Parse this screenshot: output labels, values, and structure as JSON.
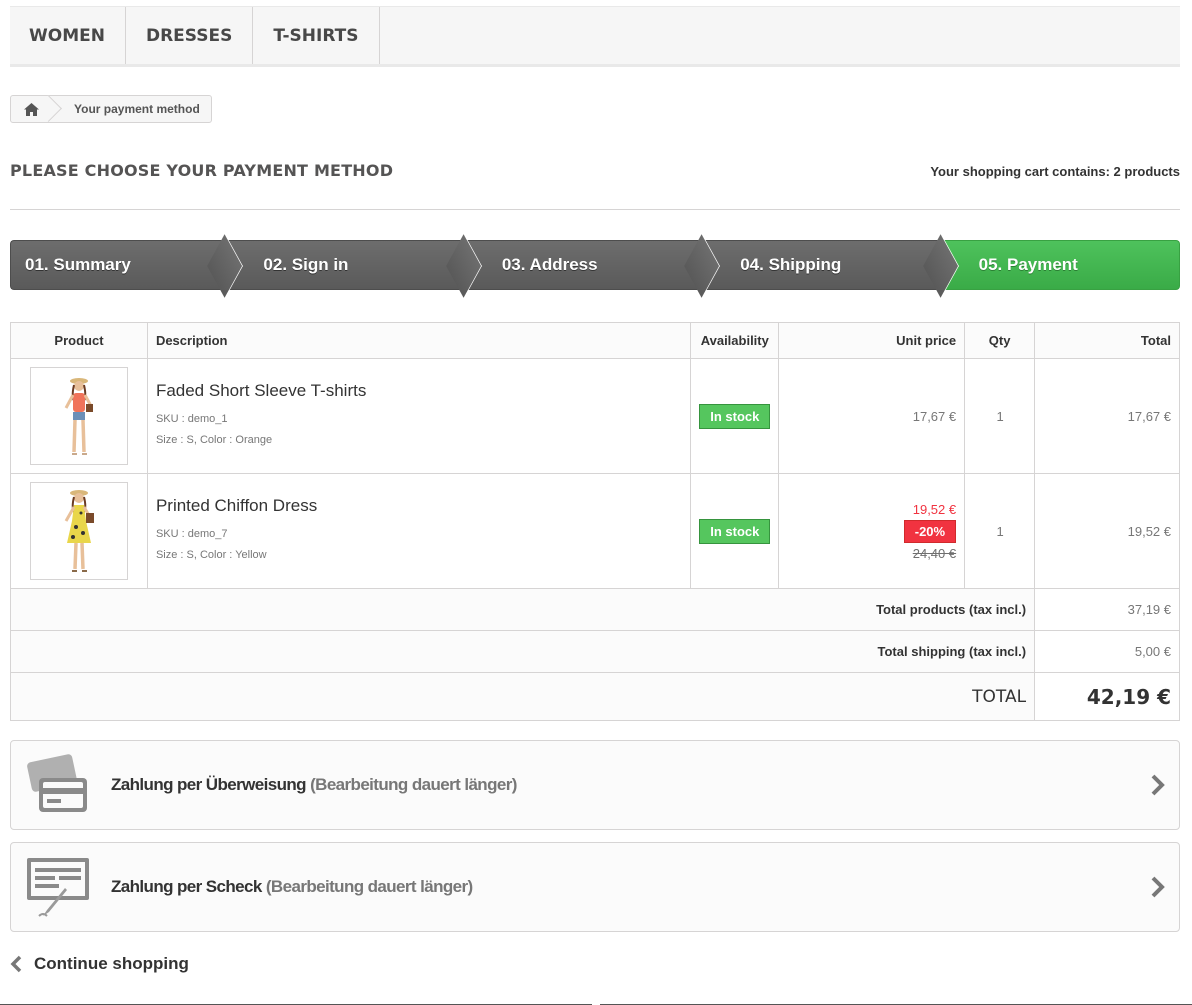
{
  "menu": {
    "items": [
      {
        "label": "WOMEN"
      },
      {
        "label": "DRESSES"
      },
      {
        "label": "T-SHIRTS"
      }
    ]
  },
  "breadcrumb": {
    "home_icon": "home-icon",
    "current": "Your payment method"
  },
  "page": {
    "heading": "PLEASE CHOOSE YOUR PAYMENT METHOD",
    "cart_count": "Your shopping cart contains: 2 products"
  },
  "steps": [
    {
      "label": "01. Summary",
      "state": "done"
    },
    {
      "label": "02. Sign in",
      "state": "done"
    },
    {
      "label": "03. Address",
      "state": "done"
    },
    {
      "label": "04. Shipping",
      "state": "done"
    },
    {
      "label": "05. Payment",
      "state": "current"
    }
  ],
  "colors": {
    "step_active": "#46b551",
    "step_inactive": "#636363",
    "in_stock": "#55c65e",
    "discount": "#f13340"
  },
  "cart": {
    "headers": {
      "product": "Product",
      "description": "Description",
      "availability": "Availability",
      "unit_price": "Unit price",
      "qty": "Qty",
      "total": "Total"
    },
    "items": [
      {
        "name": "Faded Short Sleeve T-shirts",
        "sku": "SKU : demo_1",
        "attributes": "Size : S, Color : Orange",
        "availability": "In stock",
        "unit_price": "17,67 €",
        "qty": "1",
        "total": "17,67 €"
      },
      {
        "name": "Printed Chiffon Dress",
        "sku": "SKU : demo_7",
        "attributes": "Size : S, Color : Yellow",
        "availability": "In stock",
        "unit_price": "19,52 €",
        "discount": "-20%",
        "old_price": "24,40 €",
        "qty": "1",
        "total": "19,52 €"
      }
    ],
    "totals": {
      "products_label": "Total products (tax incl.)",
      "products_value": "37,19 €",
      "shipping_label": "Total shipping (tax incl.)",
      "shipping_value": "5,00 €",
      "total_label": "TOTAL",
      "total_value": "42,19 €"
    }
  },
  "payment_options": [
    {
      "icon": "bank-card-icon",
      "name": "Zahlung per Überweisung",
      "note": "(Bearbeitung dauert länger)"
    },
    {
      "icon": "cheque-icon",
      "name": "Zahlung per Scheck",
      "note": "(Bearbeitung dauert länger)"
    }
  ],
  "footer": {
    "continue_label": "Continue shopping"
  }
}
